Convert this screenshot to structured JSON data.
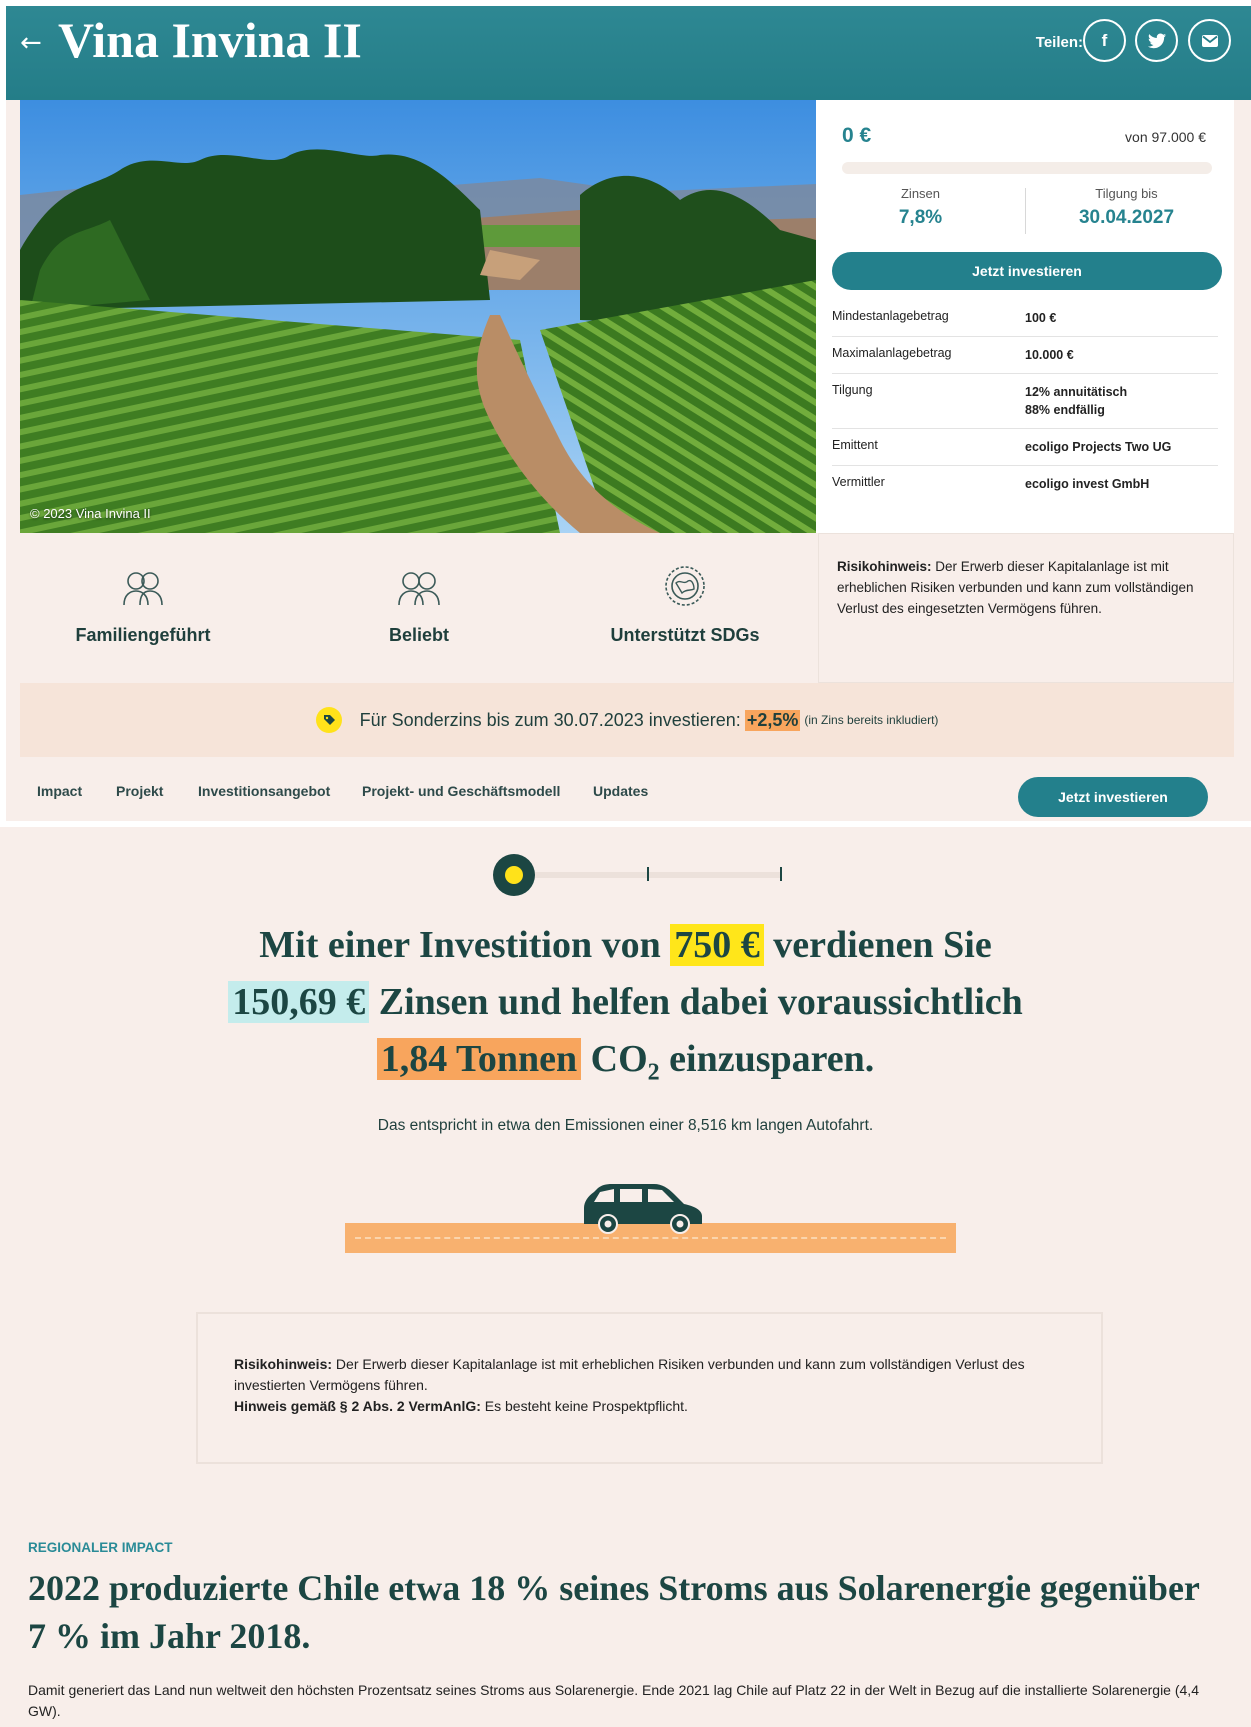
{
  "header": {
    "back_label": "←",
    "title": "Vina Invina II",
    "share_label": "Teilen:",
    "share_buttons": [
      {
        "name": "facebook",
        "glyph": "f"
      },
      {
        "name": "twitter",
        "glyph": "t"
      },
      {
        "name": "email",
        "glyph": "✉"
      }
    ]
  },
  "hero": {
    "photo_credit": "© 2023 Vina Invina II"
  },
  "investment": {
    "current_amount": "0 €",
    "goal_label": "von 97.000 €",
    "progress_fraction": 0,
    "interest_label": "Zinsen",
    "interest_value": "7,8%",
    "repayment_label": "Tilgung bis",
    "repayment_value": "30.04.2027",
    "cta_label": "Jetzt investieren",
    "details": [
      {
        "key": "Mindestanlagebetrag",
        "value": "100 €"
      },
      {
        "key": "Maximalanlagebetrag",
        "value": "10.000 €"
      },
      {
        "key": "Tilgung",
        "value": "12% annuitätisch",
        "value2": "88% endfällig"
      },
      {
        "key": "Emittent",
        "value": "ecoligo Projects Two UG"
      },
      {
        "key": "Vermittler",
        "value": "ecoligo invest GmbH"
      }
    ]
  },
  "features": [
    {
      "label": "Familiengeführt",
      "icon": "family-icon"
    },
    {
      "label": "Beliebt",
      "icon": "people-icon"
    },
    {
      "label": "Unterstützt SDGs",
      "icon": "globe-icon"
    }
  ],
  "risk_notice": {
    "title": "Risikohinweis:",
    "text": " Der Erwerb dieser Kapitalanlage ist mit erheblichen Risiken verbunden und kann zum vollständigen Verlust des eingesetzten Vermögens führen."
  },
  "bonus": {
    "text": "Für Sonderzins bis zum 30.07.2023 investieren:",
    "pct": "+2,5%",
    "note": "(in Zins bereits inkludiert)"
  },
  "subnav": {
    "items": [
      "Impact",
      "Projekt",
      "Investitionsangebot",
      "Projekt- und Geschäftsmodell",
      "Updates"
    ],
    "cta_label": "Jetzt investieren"
  },
  "calculator": {
    "slider_position": 0,
    "sentence_part1": "Mit einer Investition von",
    "amount": "750 €",
    "sentence_part2": "verdienen Sie",
    "interest": "150,69 €",
    "sentence_part3": "Zinsen und helfen dabei voraussichtlich",
    "co2": "1,84 Tonnen",
    "sentence_part4_co": "CO",
    "sentence_part4_sub": "2",
    "sentence_part4_rest": "einzusparen.",
    "equivalent": "Das entspricht in etwa den Emissionen einer 8,516 km langen Autofahrt."
  },
  "risk_notice2": {
    "title": "Risikohinweis:",
    "text": " Der Erwerb dieser Kapitalanlage ist mit erheblichen Risiken verbunden und kann zum vollständigen Verlust des investierten Vermögens führen.",
    "title2": "Hinweis gemäß § 2 Abs. 2 VermAnlG:",
    "text2": " Es besteht keine Prospektpflicht."
  },
  "impact": {
    "eyebrow": "REGIONALER IMPACT",
    "title": "2022 produzierte Chile etwa 18 % seines Stroms aus Solarenergie gegenüber 7 % im Jahr 2018.",
    "text": "Damit generiert das Land nun weltweit den höchsten Prozentsatz seines Stroms aus Solarenergie. Ende 2021 lag Chile auf Platz 22 in der Welt in Bezug auf die installierte Solarenergie (4,4 GW)."
  },
  "colors": {
    "teal": "#26838f",
    "dark_green": "#1c4643",
    "yellow": "#ffe21a",
    "orange": "#f8a55d",
    "light_blue": "#c4ecec",
    "cream": "#f8eeea"
  }
}
